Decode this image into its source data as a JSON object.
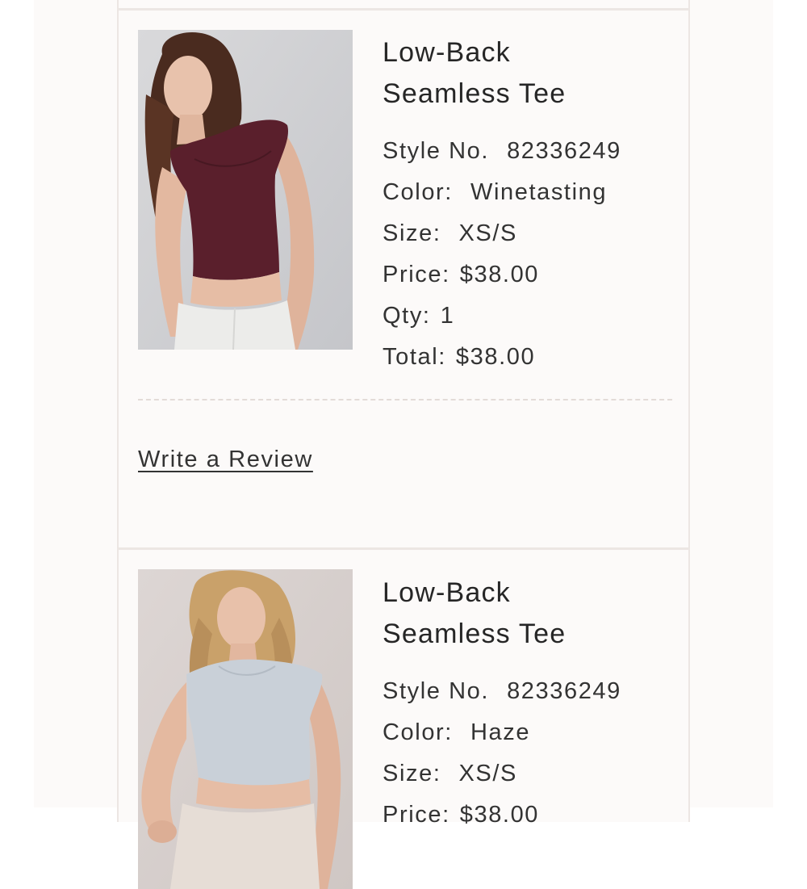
{
  "colors": {
    "page_background": "#fcfaf9",
    "card_border": "#ece6e3",
    "text": "#333333",
    "wine_shirt": "#5a1f2c",
    "haze_shirt": "#c9d0d8"
  },
  "items": [
    {
      "title_line1": "Low-Back",
      "title_line2": "Seamless Tee",
      "style_label": "Style No.",
      "style_value": "82336249",
      "color_label": "Color:",
      "color_value": "Winetasting",
      "size_label": "Size:",
      "size_value": "XS/S",
      "price_label": "Price:",
      "price_value": "$38.00",
      "qty_label": "Qty:",
      "qty_value": "1",
      "total_label": "Total:",
      "total_value": "$38.00",
      "review_label": "Write a Review"
    },
    {
      "title_line1": "Low-Back",
      "title_line2": "Seamless Tee",
      "style_label": "Style No.",
      "style_value": "82336249",
      "color_label": "Color:",
      "color_value": "Haze",
      "size_label": "Size:",
      "size_value": "XS/S",
      "price_label": "Price:",
      "price_value": "$38.00"
    }
  ]
}
